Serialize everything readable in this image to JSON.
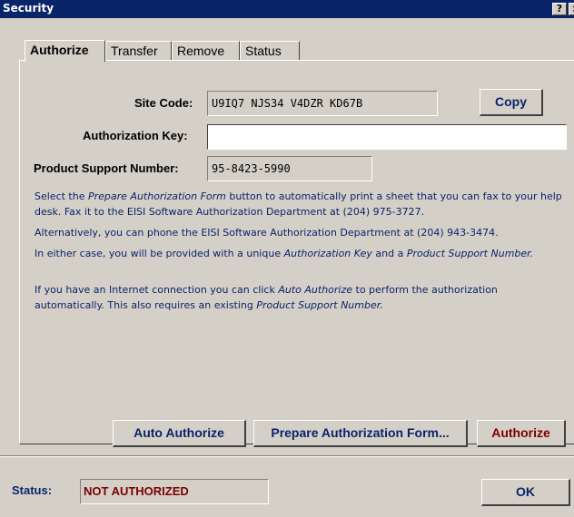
{
  "window": {
    "title": "Security",
    "help_button": "?",
    "close_button": "×"
  },
  "tabs": [
    {
      "label": "Authorize",
      "active": true
    },
    {
      "label": "Transfer",
      "active": false
    },
    {
      "label": "Remove",
      "active": false
    },
    {
      "label": "Status",
      "active": false
    }
  ],
  "site_code": {
    "label": "Site Code:",
    "value": "U9IQ7 NJS34 V4DZR KD67B"
  },
  "copy_button": "Copy",
  "authorization_key": {
    "label": "Authorization Key:",
    "value": "",
    "placeholder": ""
  },
  "product_support_number": {
    "label": "Product Support Number:",
    "value": "95-8423-5990"
  },
  "info": {
    "p1_a": "Select the ",
    "p1_b": "Prepare Authorization Form",
    "p1_c": " button to automatically print a sheet that you can fax to your help desk. Fax it to the EISI Software Authorization Department at (204) 975-3727.",
    "p2": "Alternatively, you can phone the EISI Software Authorization Department at (204) 943-3474.",
    "p3_a": "In either case, you will be provided with a unique ",
    "p3_b": "Authorization Key",
    "p3_c": " and a ",
    "p3_d": "Product Support Number.",
    "p4_a": "If you have an Internet connection you can click ",
    "p4_b": "Auto Authorize",
    "p4_c": " to perform the authorization automatically. This also requires an existing ",
    "p4_d": "Product Support Number."
  },
  "buttons": {
    "auto_authorize": "Auto Authorize",
    "prepare_form": "Prepare Authorization Form...",
    "authorize": "Authorize",
    "ok": "OK"
  },
  "status": {
    "label": "Status:",
    "value": "NOT AUTHORIZED"
  },
  "colors": {
    "title_bar": "#0a246a",
    "dialog_bg": "#d4d0c8",
    "accent_text": "#0a246a",
    "status_text": "#7b0000"
  }
}
